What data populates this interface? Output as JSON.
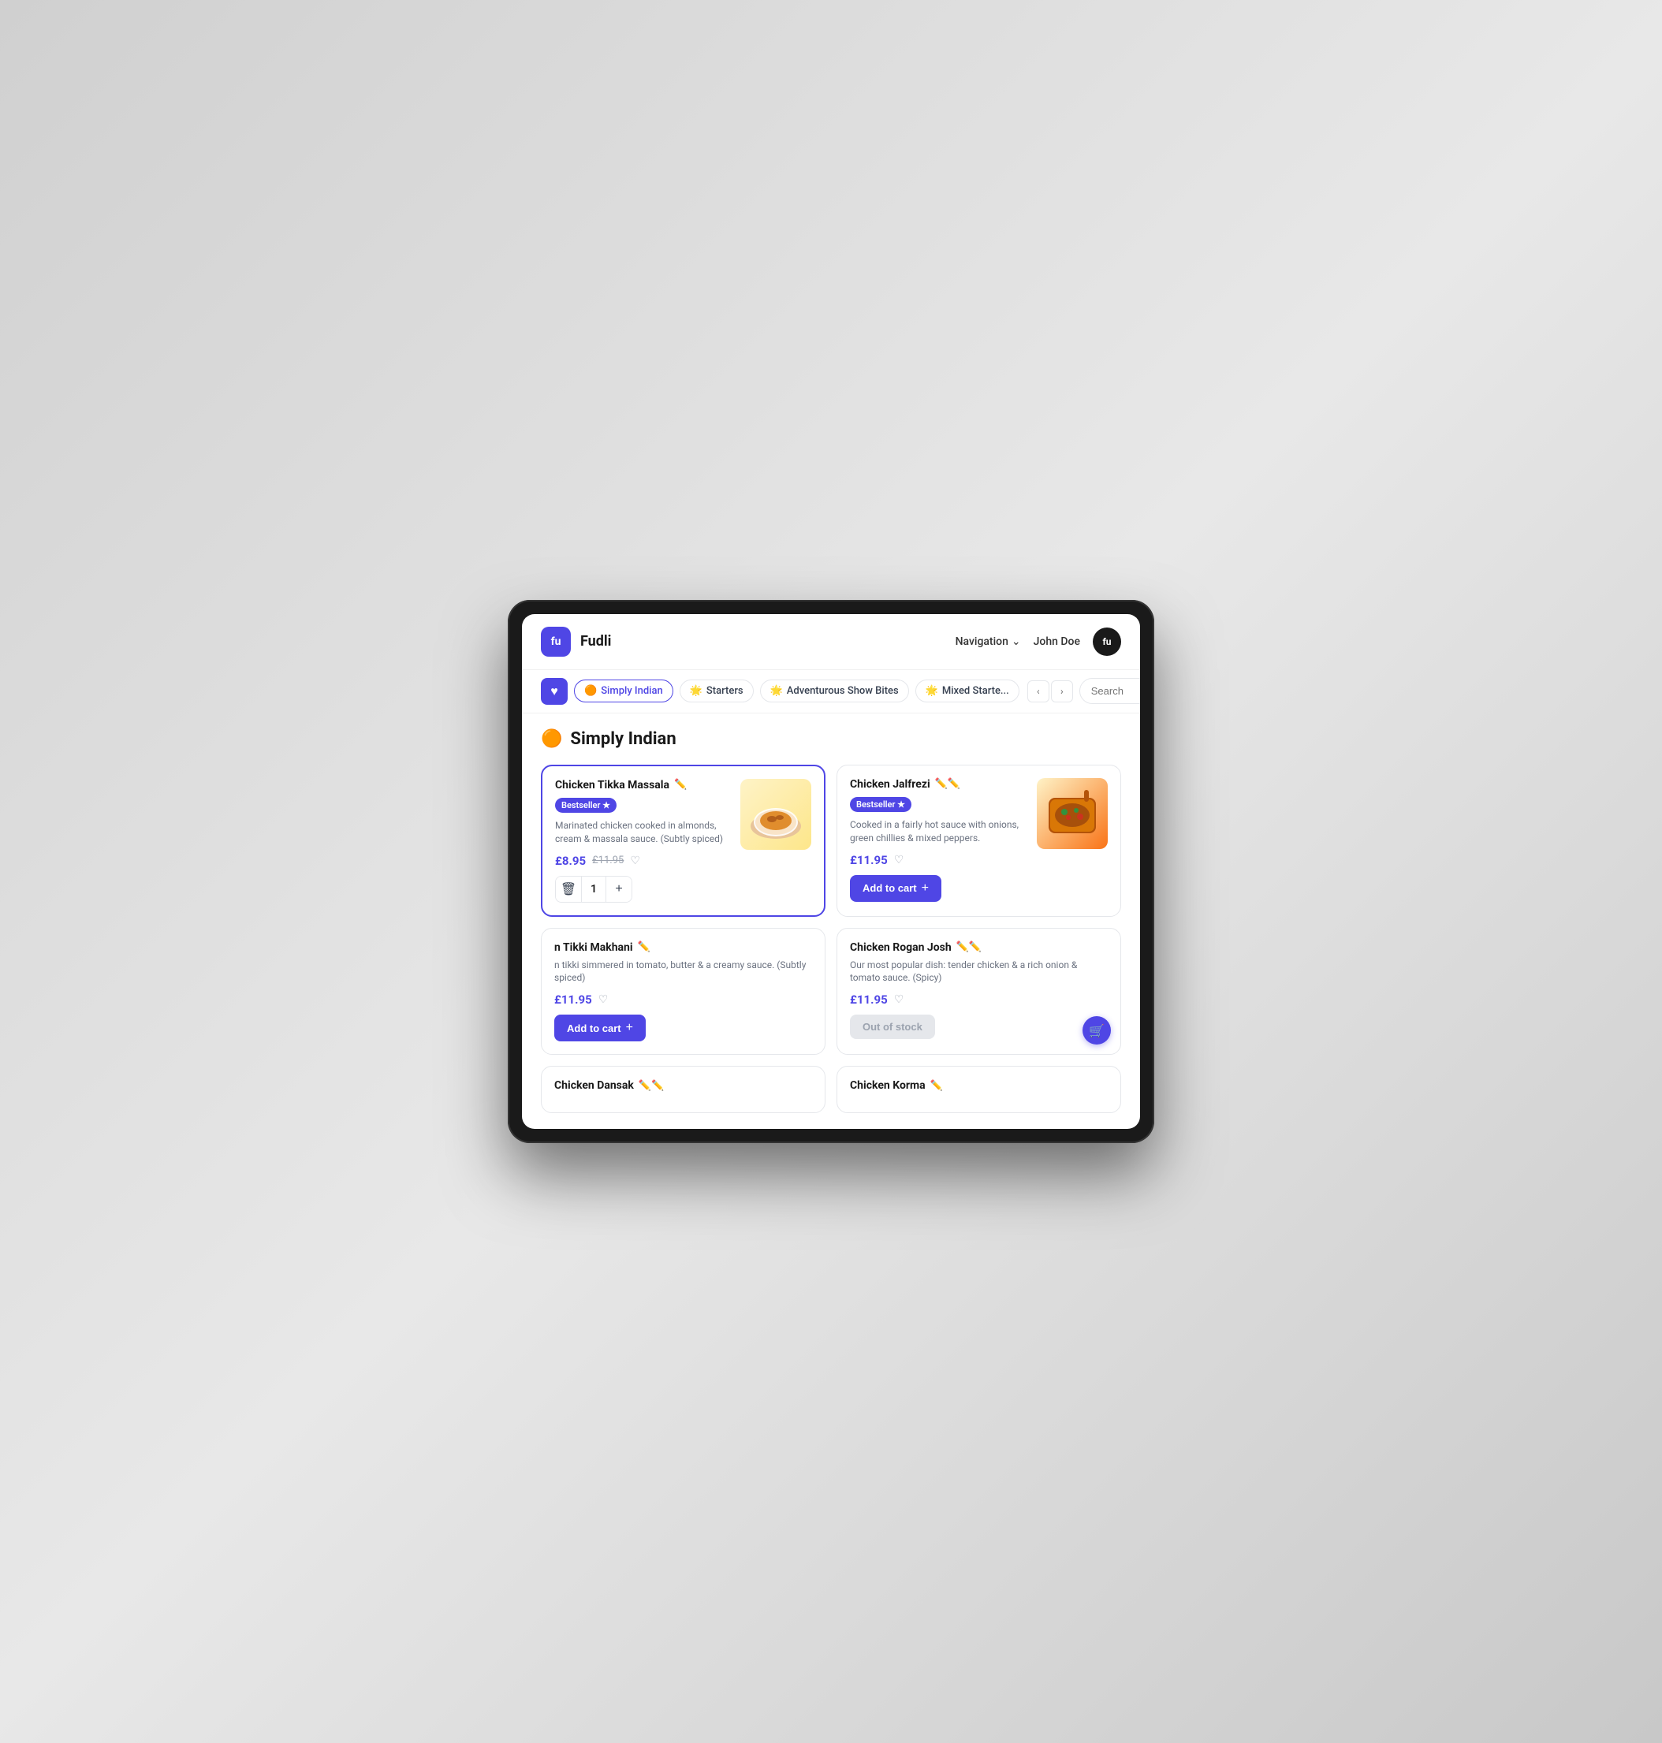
{
  "app": {
    "logo_text": "fu",
    "name": "Fudli"
  },
  "header": {
    "navigation_label": "Navigation",
    "user_name": "John Doe",
    "user_initials": "fu"
  },
  "categories": [
    {
      "id": "favorites",
      "type": "icon",
      "icon": "♥"
    },
    {
      "id": "simply-indian",
      "label": "Simply Indian",
      "emoji": "🟠",
      "active": true
    },
    {
      "id": "starters",
      "label": "Starters",
      "emoji": "🟡"
    },
    {
      "id": "adventurous",
      "label": "Adventurous Show Bites",
      "emoji": "🟡"
    },
    {
      "id": "mixed-starters",
      "label": "Mixed Starte...",
      "emoji": "🟡"
    }
  ],
  "search": {
    "placeholder": "Search"
  },
  "section": {
    "emoji": "🟠",
    "title": "Simply Indian"
  },
  "products": [
    {
      "id": "chicken-tikka-massala",
      "title": "Chicken Tikka Massala",
      "badge": "Bestseller ★",
      "description": "Marinated chicken cooked in almonds, cream & massala sauce. (Subtly spiced)",
      "price": "£8.95",
      "old_price": "£11.95",
      "quantity": 1,
      "selected": true,
      "has_image": true,
      "image_type": "tikka"
    },
    {
      "id": "chicken-jalfrezi",
      "title": "Chicken Jalfrezi",
      "badge": "Bestseller ★",
      "description": "Cooked in a fairly hot sauce with onions, green chillies & mixed peppers.",
      "price": "£11.95",
      "add_to_cart": "Add to cart",
      "selected": false,
      "has_image": true,
      "image_type": "jalfrezi"
    },
    {
      "id": "chicken-tikki-makhani",
      "title": "n Tikki Makhani",
      "description": "n tikki simmered in tomato, butter & a creamy sauce. (Subtly spiced)",
      "price": "£11.95",
      "add_to_cart": "Add to cart",
      "selected": false,
      "has_image": false
    },
    {
      "id": "chicken-rogan-josh",
      "title": "Chicken Rogan Josh",
      "description": "Our most popular dish: tender chicken & a rich onion & tomato sauce. (Spicy)",
      "price": "£11.95",
      "out_of_stock": "Out of stock",
      "selected": false,
      "has_image": false
    },
    {
      "id": "chicken-dansak",
      "title": "Chicken Dansak",
      "selected": false,
      "has_image": false
    },
    {
      "id": "chicken-korma",
      "title": "Chicken Korma",
      "selected": false,
      "has_image": false
    }
  ],
  "buttons": {
    "add_to_cart": "Add to cart",
    "out_of_stock": "Out of stock",
    "plus": "+",
    "minus": "−"
  }
}
